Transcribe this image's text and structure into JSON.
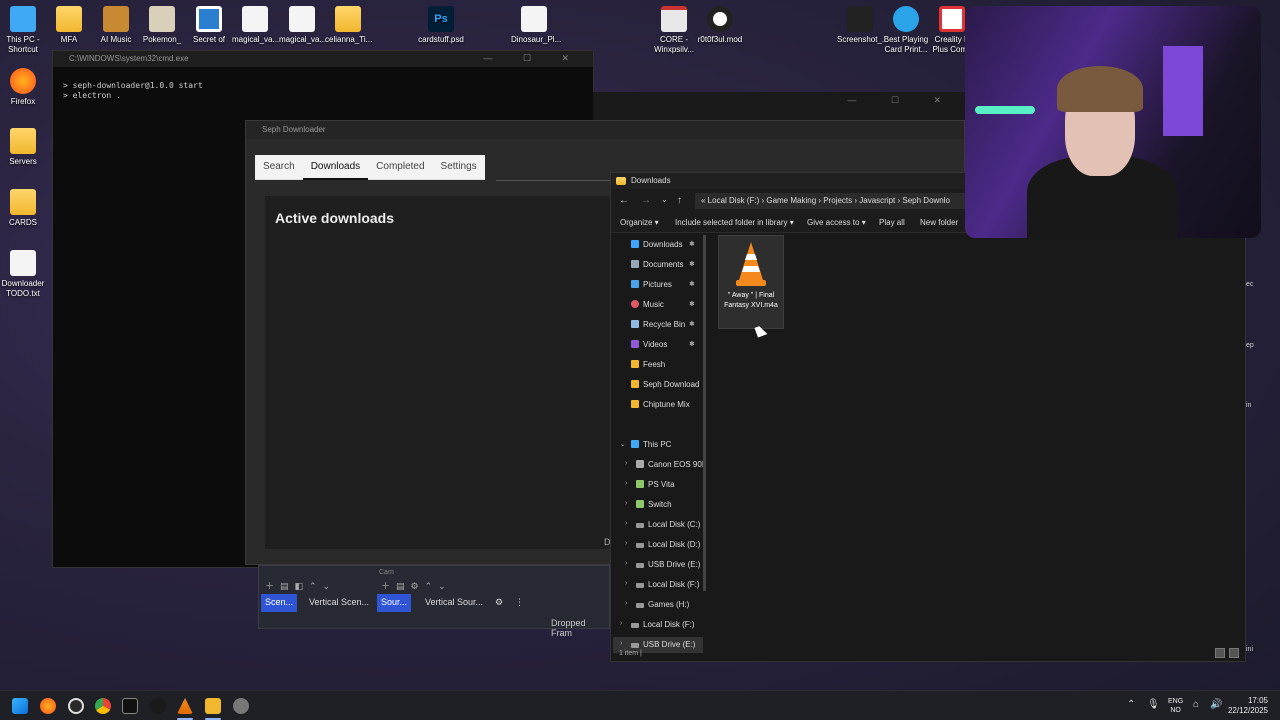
{
  "desktop": {
    "icons": [
      {
        "label": "This PC - Shortcut",
        "color": "#3fa9f5"
      },
      {
        "label": "Firefox",
        "color": "#ff6f1e"
      },
      {
        "label": "Servers",
        "color": "#f1b72e"
      },
      {
        "label": "CARDS",
        "color": "#f1b72e"
      },
      {
        "label": "Downloader TODO.txt",
        "color": "#f4f4f4"
      }
    ],
    "top_icons": [
      {
        "label": "MFA",
        "type": "folder"
      },
      {
        "label": "AI Music",
        "type": "folder"
      },
      {
        "label": "Pokemon_",
        "type": "app"
      },
      {
        "label": "Secret of",
        "type": "app"
      },
      {
        "label": "magical_va...",
        "type": "doc"
      },
      {
        "label": "magical_va...",
        "type": "doc"
      },
      {
        "label": "celianna_Ti...",
        "type": "folder"
      },
      {
        "label": "cardstuff.psd",
        "type": "psd"
      },
      {
        "label": "Dinosaur_Pl...",
        "type": "doc"
      },
      {
        "label": "CORE - Winxpsilv...",
        "type": "app"
      },
      {
        "label": "r0t0f3ul.mod",
        "type": "app"
      },
      {
        "label": "Screenshot_...",
        "type": "app"
      },
      {
        "label": "Best Playing Card Print...",
        "type": "app"
      },
      {
        "label": "Creality K Plus Comb",
        "type": "app"
      }
    ]
  },
  "cmd": {
    "title": "C:\\WINDOWS\\system32\\cmd.exe",
    "controls": "— ☐ ✕",
    "lines": [
      "> seph-downloader@1.0.0 start",
      "> electron ."
    ]
  },
  "seph": {
    "title": "Seph Downloader",
    "tabs": [
      "Search",
      "Downloads",
      "Completed",
      "Settings"
    ],
    "active_tab": "Downloads",
    "panel_title": "Active downloads",
    "side_letter": "D"
  },
  "obs": {
    "cam_label": "Cam",
    "scenes_btn": "Scen...",
    "vertical_scenes": "Vertical Scen...",
    "sources_btn": "Sour...",
    "vertical_sources": "Vertical Sour...",
    "dropped": "Dropped Fram"
  },
  "explorer": {
    "title": "Downloads",
    "address": "« Local Disk (F:) › Game Making › Projects › Javascript › Seph Downlo",
    "commands": [
      "Organize ▾",
      "Include selected folder in library ▾",
      "Give access to ▾",
      "Play all",
      "New folder"
    ],
    "quick": [
      {
        "label": "Downloads",
        "color": "#3da5ff",
        "pinned": true
      },
      {
        "label": "Documents",
        "color": "#9aa7b8",
        "pinned": true
      },
      {
        "label": "Pictures",
        "color": "#4aa3e8",
        "pinned": true
      },
      {
        "label": "Music",
        "color": "#e05a6a",
        "pinned": true
      },
      {
        "label": "Recycle Bin",
        "color": "#8fb9e0",
        "pinned": true
      },
      {
        "label": "Videos",
        "color": "#8e5ad6",
        "pinned": true
      },
      {
        "label": "Feesh",
        "color": "#f1b72e",
        "pinned": false
      },
      {
        "label": "Seph Download",
        "color": "#f1b72e",
        "pinned": false
      },
      {
        "label": "Chiptune Mix",
        "color": "#f1b72e",
        "pinned": false
      }
    ],
    "this_pc": "This PC",
    "drives": [
      {
        "label": "Canon EOS 90I"
      },
      {
        "label": "PS Vita"
      },
      {
        "label": "Switch"
      },
      {
        "label": "Local Disk (C:)"
      },
      {
        "label": "Local Disk (D:)"
      },
      {
        "label": "USB Drive (E:)"
      },
      {
        "label": "Local Disk (F:)"
      },
      {
        "label": "Games (H:)"
      },
      {
        "label": "Local Disk (F:)"
      },
      {
        "label": "USB Drive (E:)"
      }
    ],
    "file_name": "\" Away \" | Final Fantasy XVI.m4a",
    "status": "1 item  |"
  },
  "right_edge_text": [
    "ec",
    "ep",
    "in",
    "ini"
  ],
  "taskbar": {
    "lang_top": "ENG",
    "lang_bottom": "NO",
    "time": "17:05",
    "date": "22/12/2025"
  }
}
